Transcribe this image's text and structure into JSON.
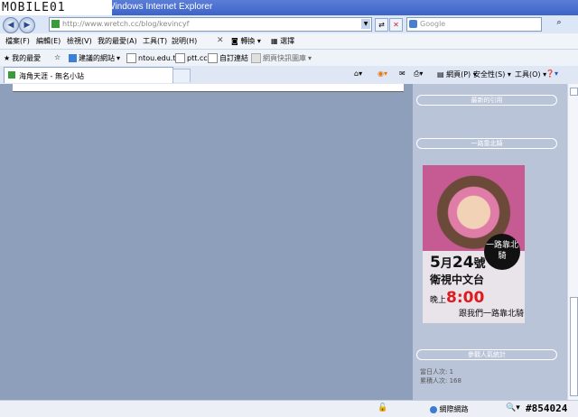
{
  "window": {
    "title": "Windows Internet Explorer",
    "watermark": "MOBILE01"
  },
  "address": {
    "url": "http://www.wretch.cc/blog/kevincyf"
  },
  "search": {
    "placeholder": "Google"
  },
  "menu": {
    "items": [
      "檔案(F)",
      "編輯(E)",
      "檢視(V)",
      "我的最愛(A)",
      "工具(T)",
      "說明(H)"
    ],
    "convert": "轉換",
    "select": "選擇"
  },
  "favorites": {
    "label": "我的最愛",
    "items": [
      "建議的網站",
      "ntou.edu.tw",
      "ptt.cc",
      "自訂連結",
      "網頁快訊圖庫"
    ]
  },
  "tab": {
    "title": "海角天涯 - 無名小站"
  },
  "tools": {
    "page": "網頁(P)",
    "safety": "安全性(S)",
    "tools": "工具(O)"
  },
  "sidebar": {
    "recent_quotes": "最新的引用",
    "bike": "一路靠北騎",
    "visitors": "參觀人氣統計",
    "today_label": "當日人次:",
    "today": "1",
    "total_label": "累積人次:",
    "total": "168"
  },
  "ad": {
    "stamp": "一路靠北騎",
    "date_month": "5",
    "date_mid": "月",
    "date_day": "24",
    "date_suffix": "號",
    "channel": "衛視中文台",
    "time_pre": "晚上",
    "time": "8:00",
    "slogan": "跟我們一路靠北騎"
  },
  "status": {
    "zone": "網際網路",
    "id": "#854024"
  },
  "colors": {
    "titlebar": "#3d63c6",
    "content_bg": "#8e9fbc",
    "sidebar_bg": "#bac4d8",
    "accent_red": "#e0191e"
  }
}
